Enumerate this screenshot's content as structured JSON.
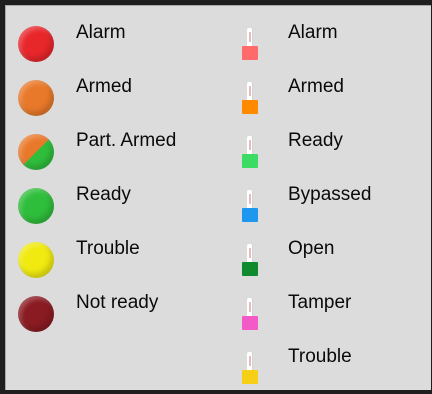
{
  "partition_legend": {
    "items": [
      {
        "label": "Alarm",
        "color": "#e8272b"
      },
      {
        "label": "Armed",
        "color": "#e9792a"
      },
      {
        "label": "Part. Armed",
        "color": "#e9792a",
        "color2": "#2fbe3c"
      },
      {
        "label": "Ready",
        "color": "#2fbe3c"
      },
      {
        "label": "Trouble",
        "color": "#f0ea11"
      },
      {
        "label": "Not ready",
        "color": "#8a1b22"
      }
    ]
  },
  "zone_legend": {
    "items": [
      {
        "label": "Alarm",
        "color": "#ff6b6b"
      },
      {
        "label": "Armed",
        "color": "#ff8a00"
      },
      {
        "label": "Ready",
        "color": "#3cdc64"
      },
      {
        "label": "Bypassed",
        "color": "#1e97ef"
      },
      {
        "label": "Open",
        "color": "#0f8a2d"
      },
      {
        "label": "Tamper",
        "color": "#f25bc7"
      },
      {
        "label": "Trouble",
        "color": "#f7cf17"
      }
    ]
  }
}
